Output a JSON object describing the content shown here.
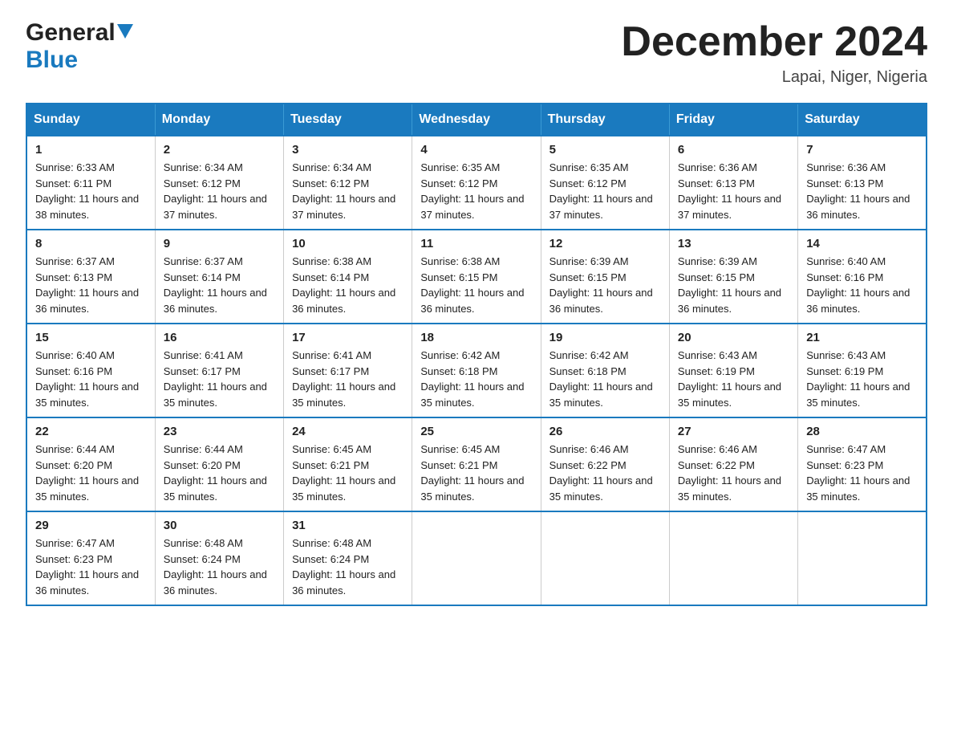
{
  "header": {
    "logo_general": "General",
    "logo_blue": "Blue",
    "month_title": "December 2024",
    "location": "Lapai, Niger, Nigeria"
  },
  "calendar": {
    "days_of_week": [
      "Sunday",
      "Monday",
      "Tuesday",
      "Wednesday",
      "Thursday",
      "Friday",
      "Saturday"
    ],
    "weeks": [
      [
        {
          "day": "1",
          "sunrise": "Sunrise: 6:33 AM",
          "sunset": "Sunset: 6:11 PM",
          "daylight": "Daylight: 11 hours and 38 minutes."
        },
        {
          "day": "2",
          "sunrise": "Sunrise: 6:34 AM",
          "sunset": "Sunset: 6:12 PM",
          "daylight": "Daylight: 11 hours and 37 minutes."
        },
        {
          "day": "3",
          "sunrise": "Sunrise: 6:34 AM",
          "sunset": "Sunset: 6:12 PM",
          "daylight": "Daylight: 11 hours and 37 minutes."
        },
        {
          "day": "4",
          "sunrise": "Sunrise: 6:35 AM",
          "sunset": "Sunset: 6:12 PM",
          "daylight": "Daylight: 11 hours and 37 minutes."
        },
        {
          "day": "5",
          "sunrise": "Sunrise: 6:35 AM",
          "sunset": "Sunset: 6:12 PM",
          "daylight": "Daylight: 11 hours and 37 minutes."
        },
        {
          "day": "6",
          "sunrise": "Sunrise: 6:36 AM",
          "sunset": "Sunset: 6:13 PM",
          "daylight": "Daylight: 11 hours and 37 minutes."
        },
        {
          "day": "7",
          "sunrise": "Sunrise: 6:36 AM",
          "sunset": "Sunset: 6:13 PM",
          "daylight": "Daylight: 11 hours and 36 minutes."
        }
      ],
      [
        {
          "day": "8",
          "sunrise": "Sunrise: 6:37 AM",
          "sunset": "Sunset: 6:13 PM",
          "daylight": "Daylight: 11 hours and 36 minutes."
        },
        {
          "day": "9",
          "sunrise": "Sunrise: 6:37 AM",
          "sunset": "Sunset: 6:14 PM",
          "daylight": "Daylight: 11 hours and 36 minutes."
        },
        {
          "day": "10",
          "sunrise": "Sunrise: 6:38 AM",
          "sunset": "Sunset: 6:14 PM",
          "daylight": "Daylight: 11 hours and 36 minutes."
        },
        {
          "day": "11",
          "sunrise": "Sunrise: 6:38 AM",
          "sunset": "Sunset: 6:15 PM",
          "daylight": "Daylight: 11 hours and 36 minutes."
        },
        {
          "day": "12",
          "sunrise": "Sunrise: 6:39 AM",
          "sunset": "Sunset: 6:15 PM",
          "daylight": "Daylight: 11 hours and 36 minutes."
        },
        {
          "day": "13",
          "sunrise": "Sunrise: 6:39 AM",
          "sunset": "Sunset: 6:15 PM",
          "daylight": "Daylight: 11 hours and 36 minutes."
        },
        {
          "day": "14",
          "sunrise": "Sunrise: 6:40 AM",
          "sunset": "Sunset: 6:16 PM",
          "daylight": "Daylight: 11 hours and 36 minutes."
        }
      ],
      [
        {
          "day": "15",
          "sunrise": "Sunrise: 6:40 AM",
          "sunset": "Sunset: 6:16 PM",
          "daylight": "Daylight: 11 hours and 35 minutes."
        },
        {
          "day": "16",
          "sunrise": "Sunrise: 6:41 AM",
          "sunset": "Sunset: 6:17 PM",
          "daylight": "Daylight: 11 hours and 35 minutes."
        },
        {
          "day": "17",
          "sunrise": "Sunrise: 6:41 AM",
          "sunset": "Sunset: 6:17 PM",
          "daylight": "Daylight: 11 hours and 35 minutes."
        },
        {
          "day": "18",
          "sunrise": "Sunrise: 6:42 AM",
          "sunset": "Sunset: 6:18 PM",
          "daylight": "Daylight: 11 hours and 35 minutes."
        },
        {
          "day": "19",
          "sunrise": "Sunrise: 6:42 AM",
          "sunset": "Sunset: 6:18 PM",
          "daylight": "Daylight: 11 hours and 35 minutes."
        },
        {
          "day": "20",
          "sunrise": "Sunrise: 6:43 AM",
          "sunset": "Sunset: 6:19 PM",
          "daylight": "Daylight: 11 hours and 35 minutes."
        },
        {
          "day": "21",
          "sunrise": "Sunrise: 6:43 AM",
          "sunset": "Sunset: 6:19 PM",
          "daylight": "Daylight: 11 hours and 35 minutes."
        }
      ],
      [
        {
          "day": "22",
          "sunrise": "Sunrise: 6:44 AM",
          "sunset": "Sunset: 6:20 PM",
          "daylight": "Daylight: 11 hours and 35 minutes."
        },
        {
          "day": "23",
          "sunrise": "Sunrise: 6:44 AM",
          "sunset": "Sunset: 6:20 PM",
          "daylight": "Daylight: 11 hours and 35 minutes."
        },
        {
          "day": "24",
          "sunrise": "Sunrise: 6:45 AM",
          "sunset": "Sunset: 6:21 PM",
          "daylight": "Daylight: 11 hours and 35 minutes."
        },
        {
          "day": "25",
          "sunrise": "Sunrise: 6:45 AM",
          "sunset": "Sunset: 6:21 PM",
          "daylight": "Daylight: 11 hours and 35 minutes."
        },
        {
          "day": "26",
          "sunrise": "Sunrise: 6:46 AM",
          "sunset": "Sunset: 6:22 PM",
          "daylight": "Daylight: 11 hours and 35 minutes."
        },
        {
          "day": "27",
          "sunrise": "Sunrise: 6:46 AM",
          "sunset": "Sunset: 6:22 PM",
          "daylight": "Daylight: 11 hours and 35 minutes."
        },
        {
          "day": "28",
          "sunrise": "Sunrise: 6:47 AM",
          "sunset": "Sunset: 6:23 PM",
          "daylight": "Daylight: 11 hours and 35 minutes."
        }
      ],
      [
        {
          "day": "29",
          "sunrise": "Sunrise: 6:47 AM",
          "sunset": "Sunset: 6:23 PM",
          "daylight": "Daylight: 11 hours and 36 minutes."
        },
        {
          "day": "30",
          "sunrise": "Sunrise: 6:48 AM",
          "sunset": "Sunset: 6:24 PM",
          "daylight": "Daylight: 11 hours and 36 minutes."
        },
        {
          "day": "31",
          "sunrise": "Sunrise: 6:48 AM",
          "sunset": "Sunset: 6:24 PM",
          "daylight": "Daylight: 11 hours and 36 minutes."
        },
        null,
        null,
        null,
        null
      ]
    ]
  }
}
